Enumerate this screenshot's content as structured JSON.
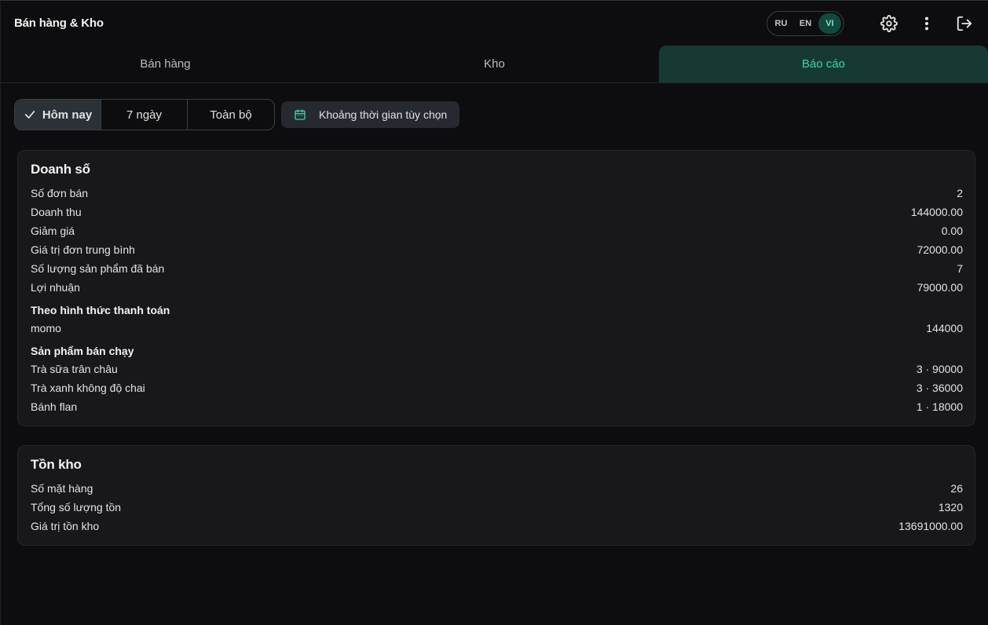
{
  "app": {
    "title": "Bán hàng & Kho"
  },
  "header": {
    "languages": [
      {
        "code": "RU",
        "active": false
      },
      {
        "code": "EN",
        "active": false
      },
      {
        "code": "VI",
        "active": true
      }
    ],
    "icons": [
      "gear-icon",
      "more-vertical-icon",
      "logout-icon"
    ]
  },
  "tabs": [
    {
      "label": "Bán hàng",
      "active": false
    },
    {
      "label": "Kho",
      "active": false
    },
    {
      "label": "Báo cáo",
      "active": true
    }
  ],
  "filters": {
    "periods": [
      {
        "label": "Hôm nay",
        "active": true
      },
      {
        "label": "7 ngày",
        "active": false
      },
      {
        "label": "Toàn bộ",
        "active": false
      }
    ],
    "custom_range_label": "Khoảng thời gian tùy chọn"
  },
  "sales": {
    "title": "Doanh số",
    "rows": [
      {
        "label": "Số đơn bán",
        "value": "2"
      },
      {
        "label": "Doanh thu",
        "value": "144000.00"
      },
      {
        "label": "Giảm giá",
        "value": "0.00"
      },
      {
        "label": "Giá trị đơn trung bình",
        "value": "72000.00"
      },
      {
        "label": "Số lượng sản phẩm đã bán",
        "value": "7"
      },
      {
        "label": "Lợi nhuận",
        "value": "79000.00"
      }
    ],
    "payment_heading": "Theo hình thức thanh toán",
    "payments": [
      {
        "label": "momo",
        "value": "144000"
      }
    ],
    "top_heading": "Sản phẩm bán chạy",
    "top_products": [
      {
        "label": "Trà sữa trân châu",
        "value": "3 · 90000"
      },
      {
        "label": "Trà xanh không độ chai",
        "value": "3 · 36000"
      },
      {
        "label": "Bánh flan",
        "value": "1 · 18000"
      }
    ]
  },
  "stock": {
    "title": "Tồn kho",
    "rows": [
      {
        "label": "Số mặt hàng",
        "value": "26"
      },
      {
        "label": "Tổng số lượng tồn",
        "value": "1320"
      },
      {
        "label": "Giá trị tồn kho",
        "value": "13691000.00"
      }
    ]
  },
  "colors": {
    "accent": "#37d6a6",
    "active_tab_bg": "#163a33",
    "background": "#0d0d0f",
    "card_bg": "#18181b"
  }
}
